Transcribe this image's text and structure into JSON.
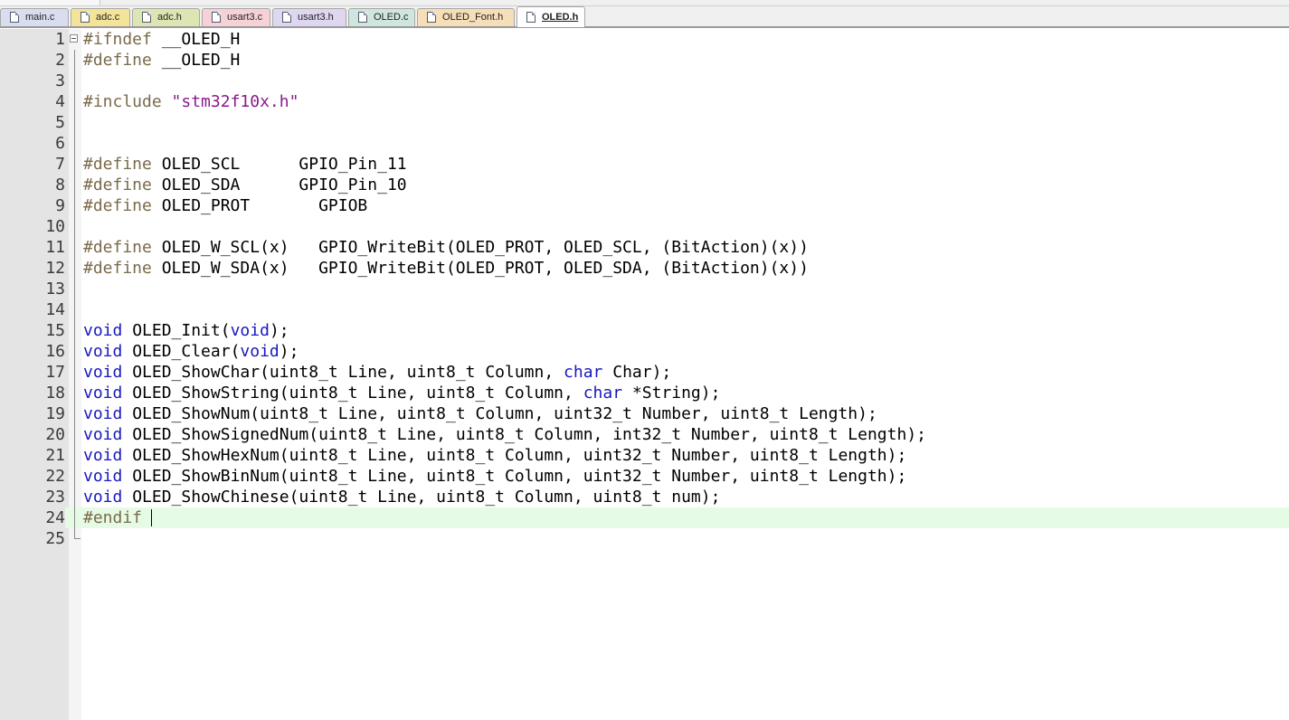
{
  "tabs": [
    {
      "label": "main.c",
      "bg": "#d8deef"
    },
    {
      "label": "adc.c",
      "bg": "#f3e49a"
    },
    {
      "label": "adc.h",
      "bg": "#dde6b3"
    },
    {
      "label": "usart3.c",
      "bg": "#f6d1d6"
    },
    {
      "label": "usart3.h",
      "bg": "#dfd6ef"
    },
    {
      "label": "OLED.c",
      "bg": "#cfe6de"
    },
    {
      "label": "OLED_Font.h",
      "bg": "#f6dfb8"
    },
    {
      "label": "OLED.h",
      "bg": "#ffffff",
      "active": true
    }
  ],
  "colors": {
    "preprocessor": "#7a6a4a",
    "string": "#8b1a8b",
    "keyword": "#1818c0",
    "plain": "#000000",
    "current_line": "#e5fbe5"
  },
  "editor": {
    "current_line": 24,
    "lines": [
      [
        {
          "t": "#ifndef",
          "c": "preprocessor"
        },
        {
          "t": " __OLED_H",
          "c": "plain"
        }
      ],
      [
        {
          "t": "#define",
          "c": "preprocessor"
        },
        {
          "t": " __OLED_H",
          "c": "plain"
        }
      ],
      [],
      [
        {
          "t": "#include",
          "c": "preprocessor"
        },
        {
          "t": " ",
          "c": "plain"
        },
        {
          "t": "\"stm32f10x.h\"",
          "c": "string"
        }
      ],
      [],
      [],
      [
        {
          "t": "#define",
          "c": "preprocessor"
        },
        {
          "t": " OLED_SCL      GPIO_Pin_11",
          "c": "plain"
        }
      ],
      [
        {
          "t": "#define",
          "c": "preprocessor"
        },
        {
          "t": " OLED_SDA      GPIO_Pin_10",
          "c": "plain"
        }
      ],
      [
        {
          "t": "#define",
          "c": "preprocessor"
        },
        {
          "t": " OLED_PROT       GPIOB",
          "c": "plain"
        }
      ],
      [],
      [
        {
          "t": "#define",
          "c": "preprocessor"
        },
        {
          "t": " OLED_W_SCL(x)   GPIO_WriteBit(OLED_PROT, OLED_SCL, (BitAction)(x))",
          "c": "plain"
        }
      ],
      [
        {
          "t": "#define",
          "c": "preprocessor"
        },
        {
          "t": " OLED_W_SDA(x)   GPIO_WriteBit(OLED_PROT, OLED_SDA, (BitAction)(x))",
          "c": "plain"
        }
      ],
      [],
      [],
      [
        {
          "t": "void",
          "c": "keyword"
        },
        {
          "t": " OLED_Init(",
          "c": "plain"
        },
        {
          "t": "void",
          "c": "keyword"
        },
        {
          "t": ");",
          "c": "plain"
        }
      ],
      [
        {
          "t": "void",
          "c": "keyword"
        },
        {
          "t": " OLED_Clear(",
          "c": "plain"
        },
        {
          "t": "void",
          "c": "keyword"
        },
        {
          "t": ");",
          "c": "plain"
        }
      ],
      [
        {
          "t": "void",
          "c": "keyword"
        },
        {
          "t": " OLED_ShowChar(uint8_t Line, uint8_t Column, ",
          "c": "plain"
        },
        {
          "t": "char",
          "c": "keyword"
        },
        {
          "t": " Char);",
          "c": "plain"
        }
      ],
      [
        {
          "t": "void",
          "c": "keyword"
        },
        {
          "t": " OLED_ShowString(uint8_t Line, uint8_t Column, ",
          "c": "plain"
        },
        {
          "t": "char",
          "c": "keyword"
        },
        {
          "t": " *String);",
          "c": "plain"
        }
      ],
      [
        {
          "t": "void",
          "c": "keyword"
        },
        {
          "t": " OLED_ShowNum(uint8_t Line, uint8_t Column, uint32_t Number, uint8_t Length);",
          "c": "plain"
        }
      ],
      [
        {
          "t": "void",
          "c": "keyword"
        },
        {
          "t": " OLED_ShowSignedNum(uint8_t Line, uint8_t Column, int32_t Number, uint8_t Length);",
          "c": "plain"
        }
      ],
      [
        {
          "t": "void",
          "c": "keyword"
        },
        {
          "t": " OLED_ShowHexNum(uint8_t Line, uint8_t Column, uint32_t Number, uint8_t Length);",
          "c": "plain"
        }
      ],
      [
        {
          "t": "void",
          "c": "keyword"
        },
        {
          "t": " OLED_ShowBinNum(uint8_t Line, uint8_t Column, uint32_t Number, uint8_t Length);",
          "c": "plain"
        }
      ],
      [
        {
          "t": "void",
          "c": "keyword"
        },
        {
          "t": " OLED_ShowChinese(uint8_t Line, uint8_t Column, uint8_t num);",
          "c": "plain"
        }
      ],
      [
        {
          "t": "#endif",
          "c": "preprocessor"
        }
      ],
      []
    ]
  }
}
